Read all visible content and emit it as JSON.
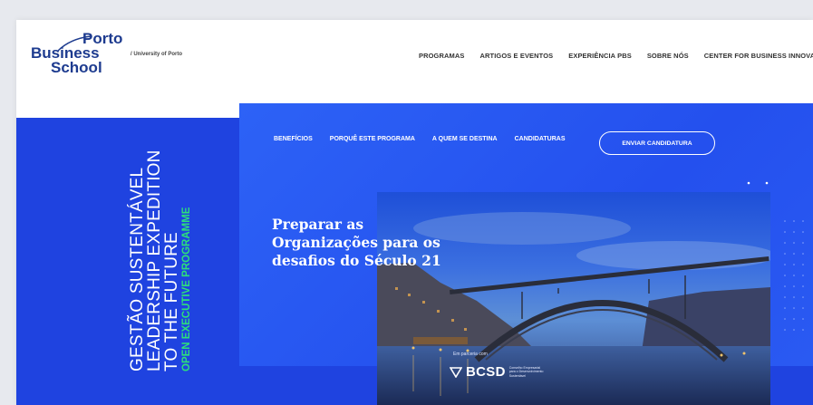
{
  "logo": {
    "line1": "Porto",
    "line2": "Business",
    "line3": "School"
  },
  "university": "/ University of Porto",
  "topnav": [
    "PROGRAMAS",
    "ARTIGOS E EVENTOS",
    "EXPERIÊNCIA PBS",
    "SOBRE NÓS",
    "CENTER FOR BUSINESS INNOVATIO"
  ],
  "program": {
    "line1": "GESTÃO SUSTENTÁVEL",
    "line2": "LEADERSHIP EXPEDITION",
    "line3": "TO THE FUTURE",
    "type": "OPEN EXECUTIVE PROGRAMME"
  },
  "subnav": [
    "BENEFÍCIOS",
    "PORQUÊ ESTE PROGRAMA",
    "A QUEM SE DESTINA",
    "CANDIDATURAS"
  ],
  "cta_label": "ENVIAR CANDIDATURA",
  "headline": [
    "Preparar as",
    "Organizações para os",
    "desafios do Século 21"
  ],
  "partner": {
    "label": "Em parceria com",
    "name": "BCSD",
    "desc": "Conselho Empresarial para o Desenvolvimento Sustentável"
  },
  "colors": {
    "brand": "#1d3b8f",
    "hero": "#1f43e0",
    "panel": "#2a5bf2",
    "accent": "#2de07a"
  }
}
